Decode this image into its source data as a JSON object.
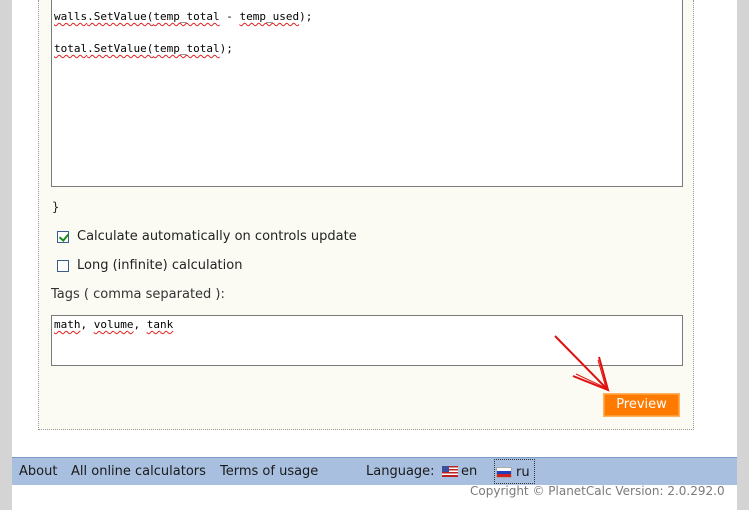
{
  "editor": {
    "code_lines": [
      {
        "obj": "walls",
        "rest": ".SetValue(",
        "arg": "temp_total",
        "rest2": " - ",
        "arg2": "temp_used",
        "end": ");"
      },
      {
        "obj": "total",
        "rest": ".SetValue(",
        "arg": "temp_total",
        "rest2": "",
        "arg2": "",
        "end": ");"
      }
    ],
    "closing_brace": "}"
  },
  "options": {
    "auto_calc": {
      "label": "Calculate automatically on controls update",
      "checked": true
    },
    "long_calc": {
      "label": "Long (infinite) calculation",
      "checked": false
    }
  },
  "tags": {
    "label": "Tags ( comma separated ):",
    "value_parts": [
      "math",
      ", ",
      "volume",
      ", ",
      "tank"
    ]
  },
  "preview_button": {
    "label": "Preview",
    "color": "#ff7a00"
  },
  "footer": {
    "about": "About",
    "all_calculators": "All online calculators",
    "terms": "Terms of usage",
    "language_label": "Language:",
    "lang_en": "en",
    "lang_ru": "ru",
    "background": "#a8bfdf"
  },
  "copyright": "Copyright © PlanetCalc Version: 2.0.292.0"
}
